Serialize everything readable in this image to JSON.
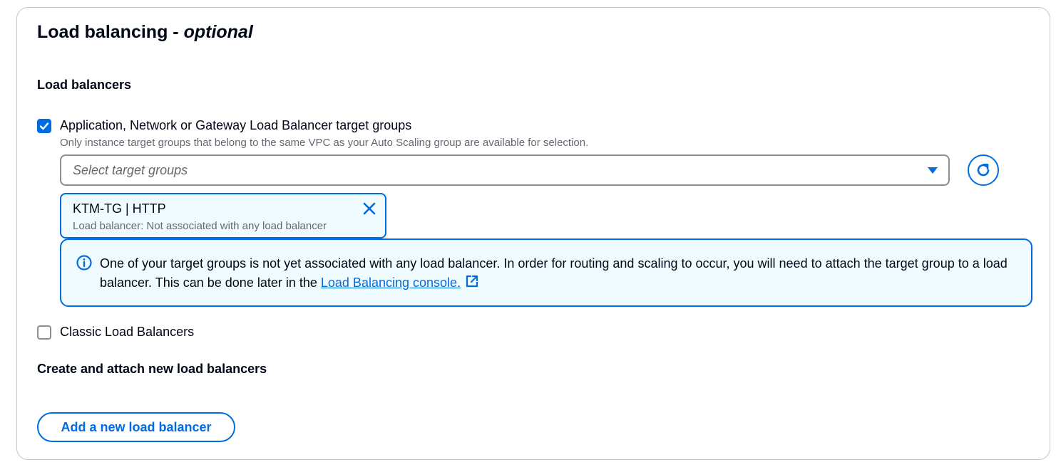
{
  "section": {
    "title": "Load balancing - ",
    "title_optional": "optional"
  },
  "load_balancers": {
    "heading": "Load balancers",
    "target_groups_option": {
      "label": "Application, Network or Gateway Load Balancer target groups",
      "checked": true,
      "description": "Only instance target groups that belong to the same VPC as your Auto Scaling group are available for selection."
    },
    "select": {
      "placeholder": "Select target groups"
    },
    "selected_token": {
      "title": "KTM-TG | HTTP",
      "subtitle": "Load balancer: Not associated with any load balancer"
    },
    "alert": {
      "text": "One of your target groups is not yet associated with any load balancer. In order for routing and scaling to occur, you will need to attach the target group to a load balancer. This can be done later in the ",
      "link_text": "Load Balancing console."
    },
    "classic_option": {
      "label": "Classic Load Balancers",
      "checked": false
    }
  },
  "create_new": {
    "heading": "Create and attach new load balancers",
    "button_label": "Add a new load balancer"
  },
  "colors": {
    "accent": "#006ce0",
    "info_background": "#f0fbff",
    "border": "#8c8c94",
    "text": "#000716",
    "secondary_text": "#656871"
  },
  "icons": {
    "checkbox_check": "check-icon",
    "select_caret": "caret-down-icon",
    "refresh": "refresh-icon",
    "token_dismiss": "close-icon",
    "alert": "info-icon",
    "external_link": "external-link-icon"
  }
}
